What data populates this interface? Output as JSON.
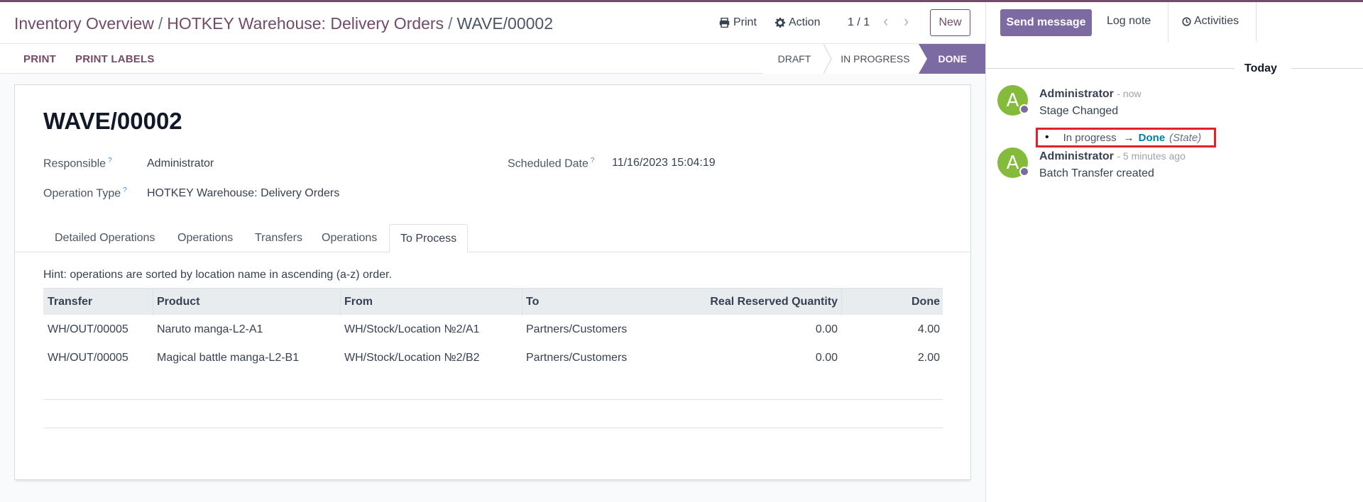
{
  "breadcrumb": {
    "items": [
      "Inventory Overview",
      "HOTKEY Warehouse: Delivery Orders"
    ],
    "current": "WAVE/00002"
  },
  "toolbar": {
    "print_label": "Print",
    "action_label": "Action",
    "pager": "1 / 1",
    "new_label": "New"
  },
  "header_buttons": {
    "print": "PRINT",
    "print_labels": "PRINT LABELS"
  },
  "statusbar": {
    "stages": [
      "DRAFT",
      "IN PROGRESS",
      "DONE"
    ],
    "current": "DONE"
  },
  "record": {
    "name": "WAVE/00002",
    "responsible_label": "Responsible",
    "responsible": "Administrator",
    "operation_type_label": "Operation Type",
    "operation_type": "HOTKEY Warehouse: Delivery Orders",
    "scheduled_date_label": "Scheduled Date",
    "scheduled_date": "11/16/2023 15:04:19",
    "help_mark": "?"
  },
  "tabs": [
    "Detailed Operations",
    "Operations",
    "Transfers",
    "Operations",
    "To Process"
  ],
  "active_tab": "To Process",
  "hint": "Hint: operations are sorted by location name in ascending (a-z) order.",
  "table": {
    "columns": [
      "Transfer",
      "Product",
      "From",
      "To",
      "Real Reserved Quantity",
      "Done"
    ],
    "rows": [
      [
        "WH/OUT/00005",
        "Naruto manga-L2-A1",
        "WH/Stock/Location №2/A1",
        "Partners/Customers",
        "0.00",
        "4.00"
      ],
      [
        "WH/OUT/00005",
        "Magical battle manga-L2-B1",
        "WH/Stock/Location №2/B2",
        "Partners/Customers",
        "0.00",
        "2.00"
      ]
    ]
  },
  "chatter": {
    "send_message": "Send message",
    "log_note": "Log note",
    "activities": "Activities",
    "day": "Today",
    "messages": [
      {
        "avatar": "A",
        "author": "Administrator",
        "when": "- now",
        "body": "Stage Changed",
        "tracking": {
          "old": "In progress",
          "arrow": "→",
          "new": "Done",
          "field": "(State)"
        }
      },
      {
        "avatar": "A",
        "author": "Administrator",
        "when": "- 5 minutes ago",
        "body": "Batch Transfer created"
      }
    ]
  },
  "colors": {
    "brand": "#714b67",
    "stage_active": "#7c6aa3",
    "avatar": "#84bb3a",
    "highlight_box": "#e5202d",
    "tracking_new": "#0180a5"
  }
}
